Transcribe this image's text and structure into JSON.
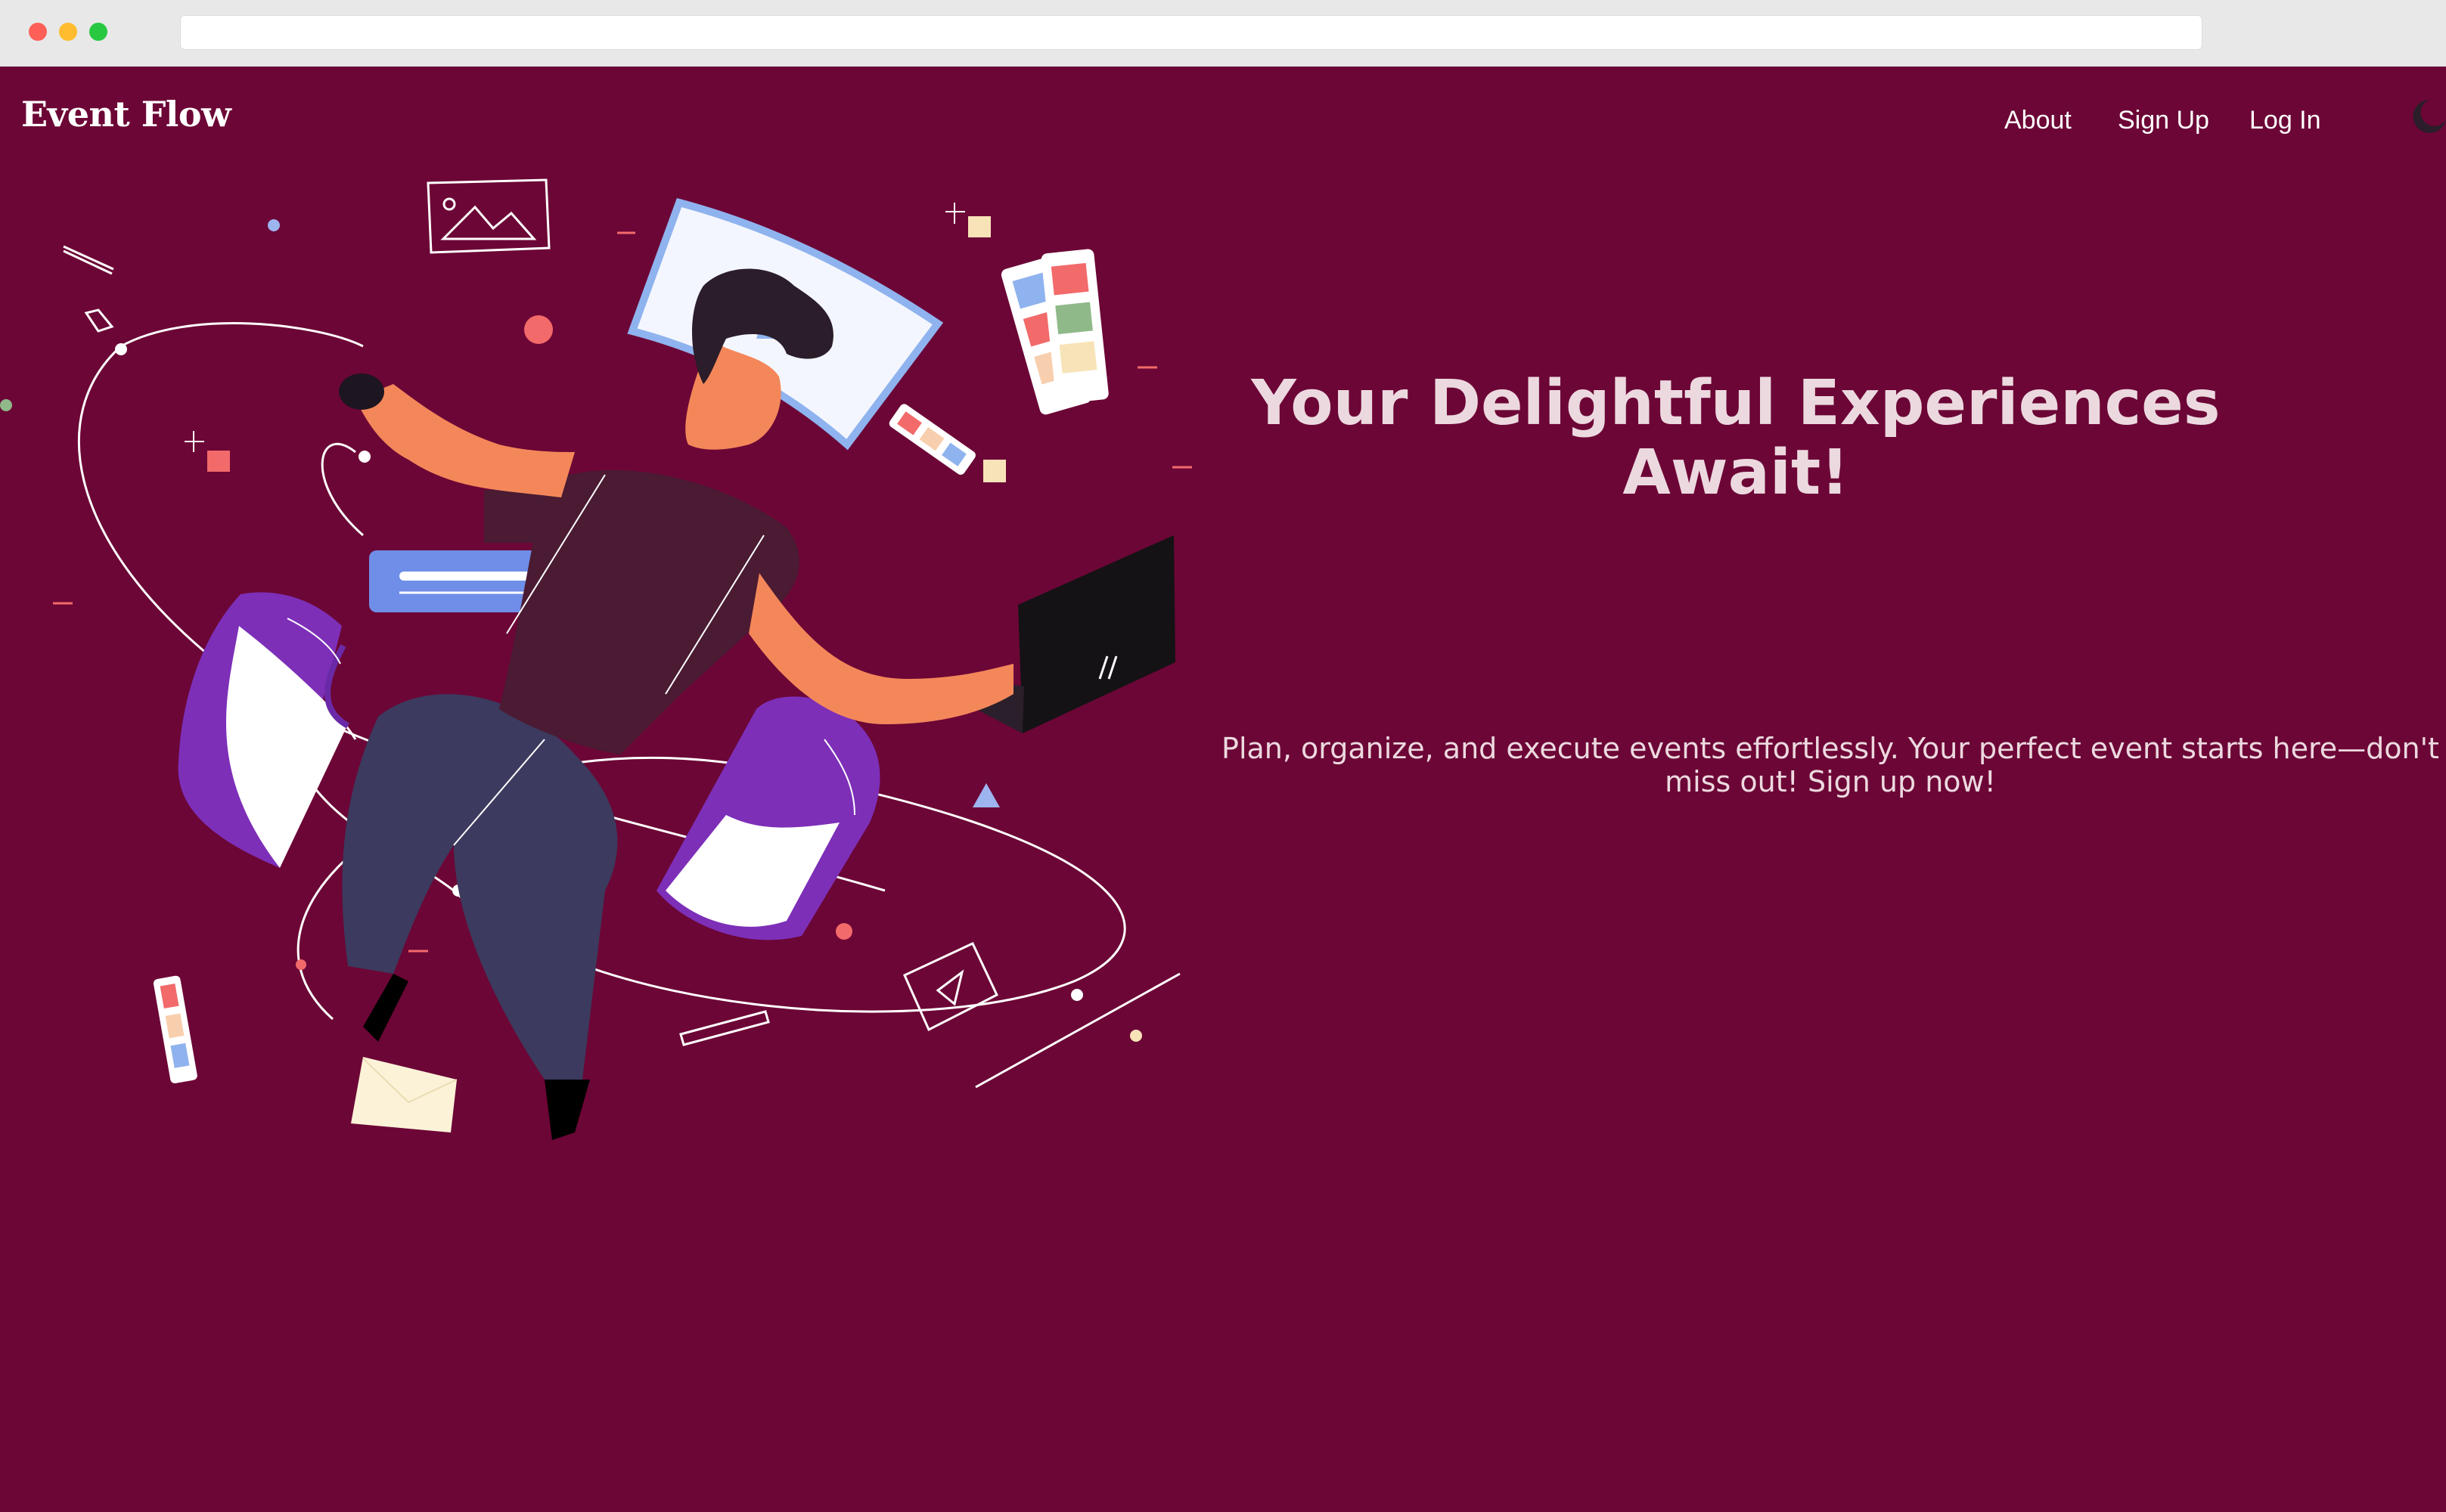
{
  "app": {
    "brand": "Event Flow"
  },
  "nav": {
    "about": "About",
    "signup": "Sign Up",
    "login": "Log In",
    "theme_icon": "moon-icon"
  },
  "hero": {
    "title": "Your Delightful Experiences Await!",
    "subtitle": "Plan, organize, and execute events effortlessly. Your perfect event starts here—don't miss out! Sign up now!",
    "illustration_icon": "designer-illustration"
  },
  "colors": {
    "background": "#6c0636",
    "title_text": "#ecd9df",
    "nav_text": "#ffffff",
    "accent_blue": "#6f8ee8",
    "skin": "#f4875a",
    "purple": "#6a2aa8"
  }
}
